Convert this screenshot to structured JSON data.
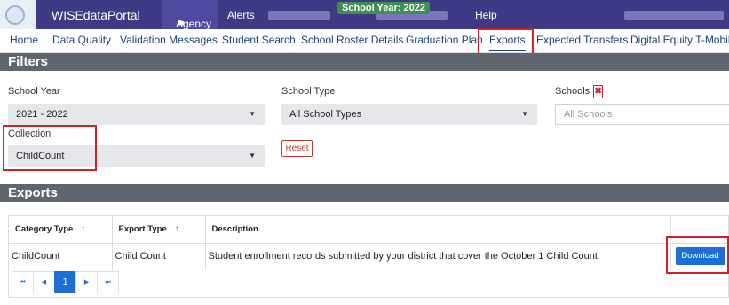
{
  "header": {
    "app_name": "WISEdataPortal",
    "nav_agency": "Agency",
    "nav_alerts": "Alerts",
    "school_year_badge": "School Year: 2022",
    "nav_help": "Help"
  },
  "subnav": {
    "items": [
      "Home",
      "Data Quality",
      "Validation Messages",
      "Student Search",
      "School Roster Details",
      "Graduation Plan",
      "Exports",
      "Expected Transfers",
      "Digital Equity T-Mobile"
    ]
  },
  "filters": {
    "heading": "Filters",
    "school_year_label": "School Year",
    "school_year_value": "2021 - 2022",
    "school_type_label": "School Type",
    "school_type_value": "All School Types",
    "schools_label": "Schools",
    "schools_placeholder": "All Schools",
    "collection_label": "Collection",
    "collection_value": "ChildCount",
    "reset_label": "Reset"
  },
  "exports": {
    "heading": "Exports",
    "columns": [
      "Category Type",
      "Export Type",
      "Description",
      ""
    ],
    "rows": [
      {
        "category": "ChildCount",
        "export_type": "Child Count",
        "description": "Student enrollment records submitted by your district that cover the October 1 Child Count",
        "action": "Download"
      }
    ],
    "pager": {
      "first": "⏮",
      "prev": "◀",
      "page": "1",
      "next": "▶",
      "last": "⏭"
    }
  },
  "icons": {
    "sort": "sort-ascending-icon",
    "remove": "remove-x-icon",
    "caret": "caret-down-icon"
  },
  "colors": {
    "topbar": "#3f3a86",
    "section_header": "#5f6670",
    "accent": "#1d6fd8",
    "highlight": "#d21f2a"
  }
}
